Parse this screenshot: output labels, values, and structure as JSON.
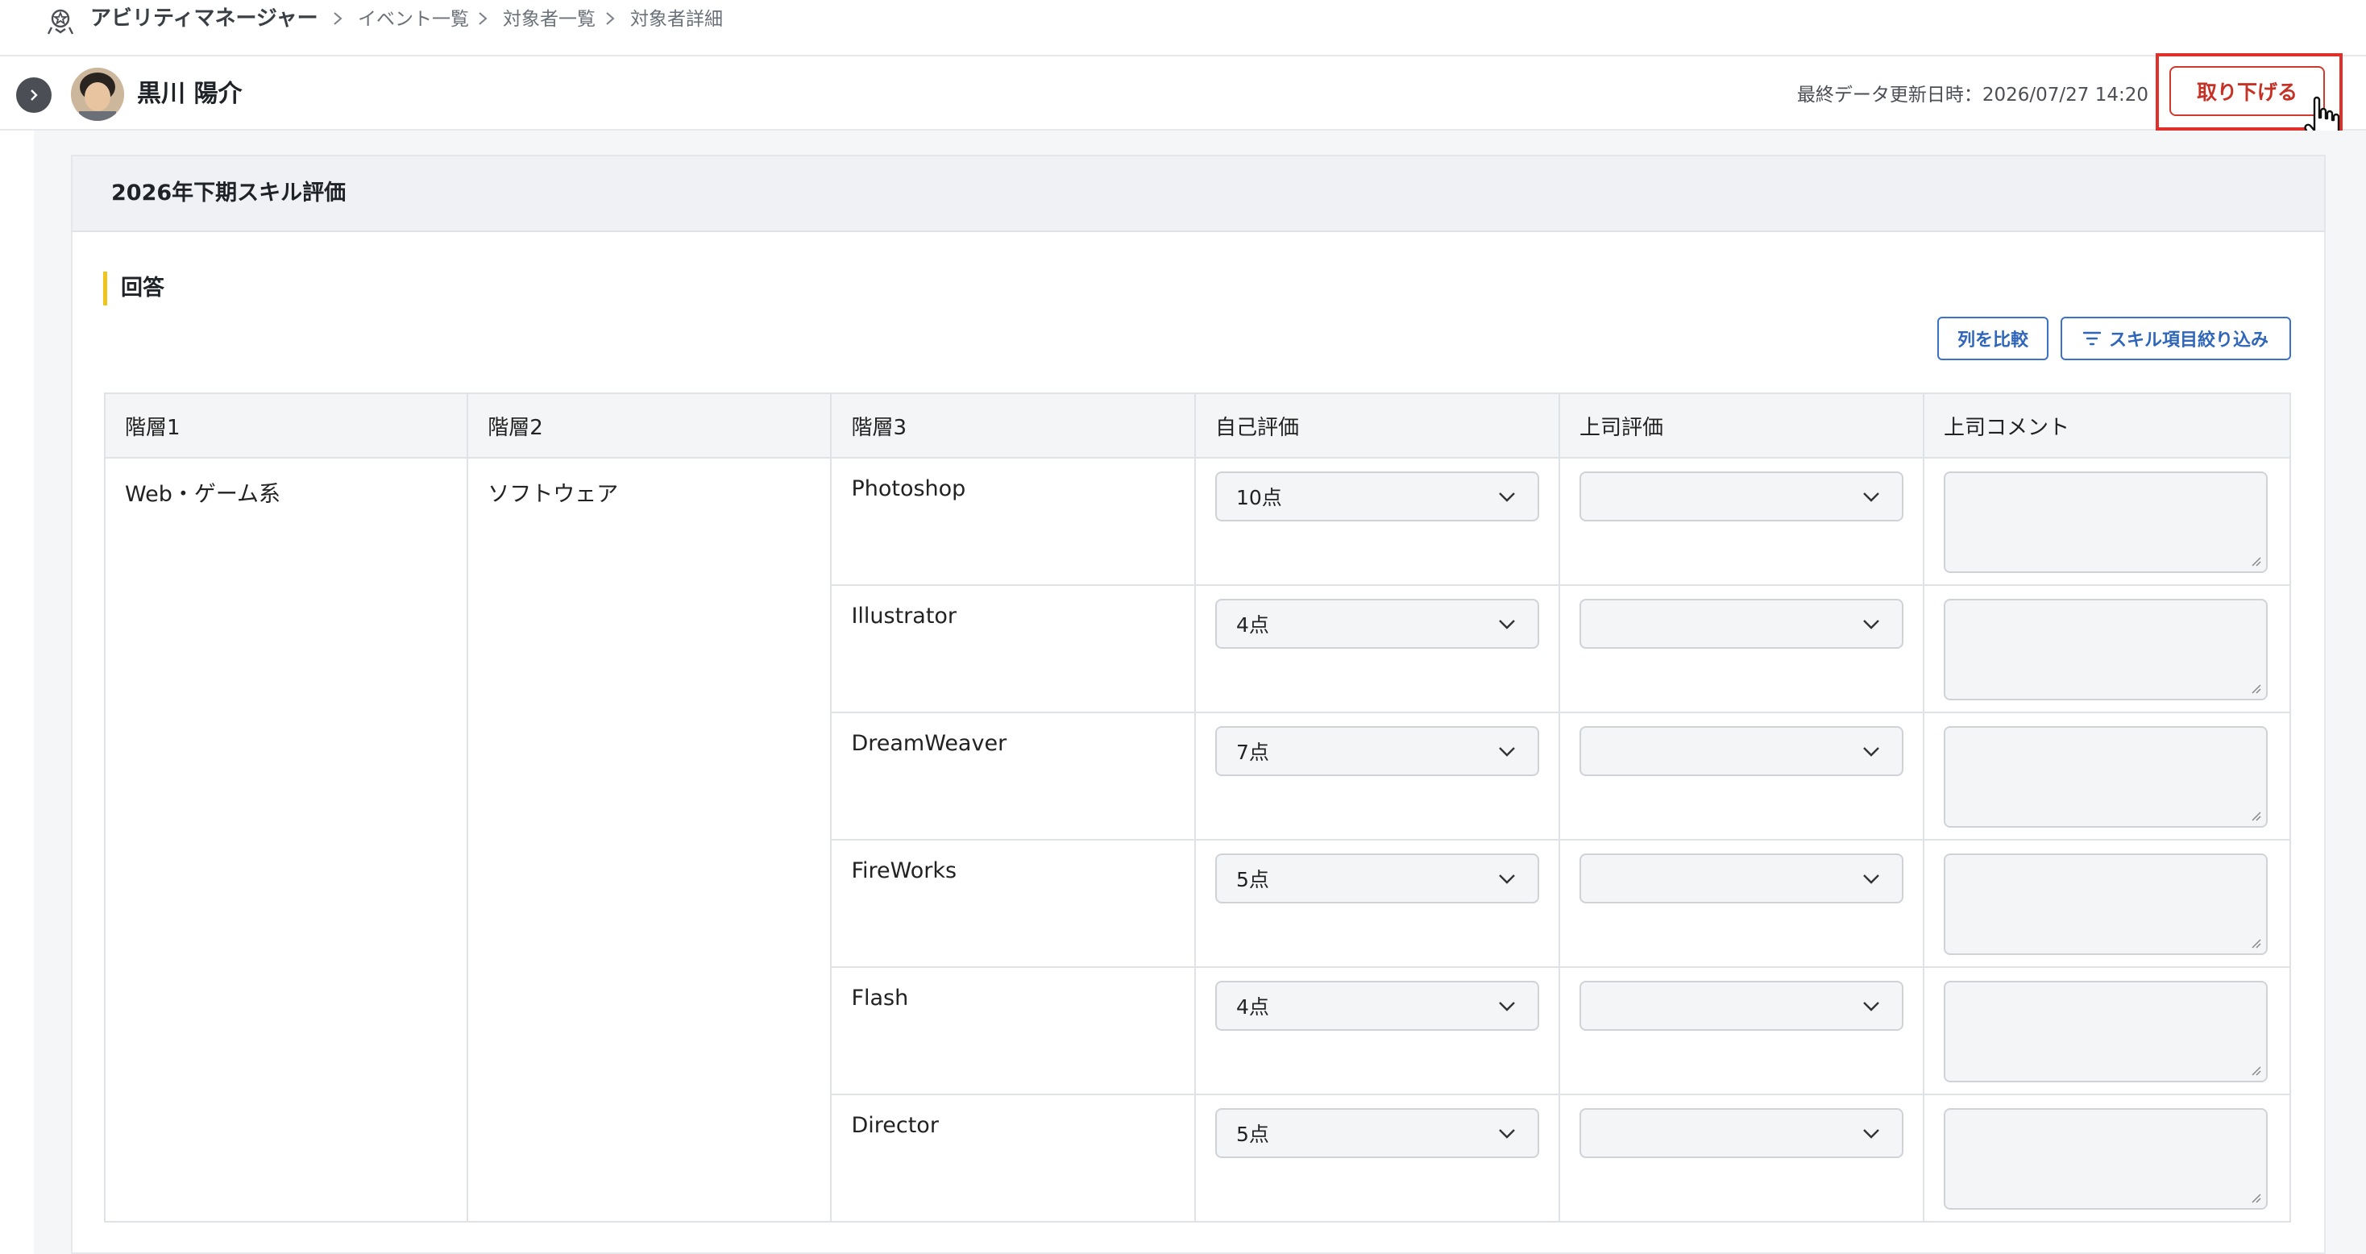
{
  "header": {
    "app_name": "アビリティマネージャー",
    "breadcrumbs": [
      "イベント一覧",
      "対象者一覧",
      "対象者詳細"
    ]
  },
  "person": {
    "name": "黒川 陽介",
    "last_updated": "最終データ更新日時：2026/07/27 14:20",
    "withdraw_label": "取り下げる"
  },
  "panel": {
    "title": "2026年下期スキル評価",
    "section_title": "回答",
    "compare_label": "列を比較",
    "filter_label": "スキル項目絞り込み"
  },
  "table": {
    "headers": [
      "階層1",
      "階層2",
      "階層3",
      "自己評価",
      "上司評価",
      "上司コメント"
    ],
    "level1": "Web・ゲーム系",
    "level2": "ソフトウェア",
    "rows": [
      {
        "skill": "Photoshop",
        "self": "10点",
        "boss": "",
        "comment": ""
      },
      {
        "skill": "Illustrator",
        "self": "4点",
        "boss": "",
        "comment": ""
      },
      {
        "skill": "DreamWeaver",
        "self": "7点",
        "boss": "",
        "comment": ""
      },
      {
        "skill": "FireWorks",
        "self": "5点",
        "boss": "",
        "comment": ""
      },
      {
        "skill": "Flash",
        "self": "4点",
        "boss": "",
        "comment": ""
      },
      {
        "skill": "Director",
        "self": "5点",
        "boss": "",
        "comment": ""
      }
    ]
  },
  "colors": {
    "accent_blue": "#3b73c6",
    "danger_red": "#c63126",
    "highlight_red": "#e0302b",
    "section_yellow": "#f0c419"
  }
}
